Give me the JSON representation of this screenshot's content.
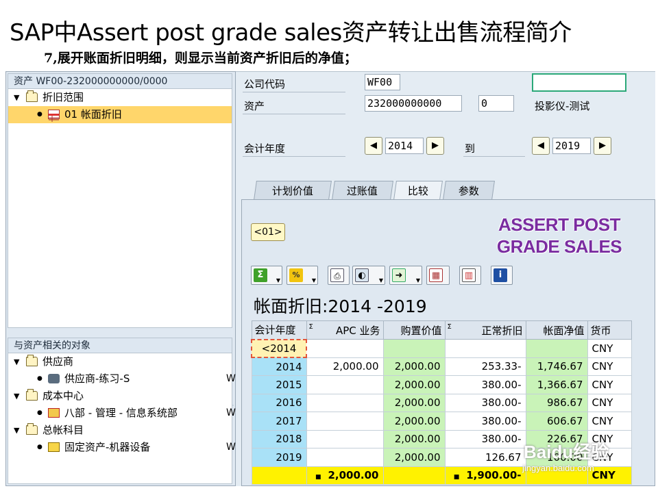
{
  "slide": {
    "title": "SAP中Assert post grade sales资产转让出售流程简介",
    "subtitle": "7,展开账面折旧明细，则显示当前资产折旧后的净值；"
  },
  "left_top": {
    "header": "资产 WF00-232000000000/0000",
    "items": [
      {
        "label": "折旧范围",
        "icon": "folder-icon"
      },
      {
        "label": "01  帐面折旧",
        "icon": "table-icon"
      }
    ]
  },
  "left_bottom": {
    "header": "与资产相关的对象",
    "groups": [
      {
        "label": "供应商",
        "child": "供应商-练习-S",
        "child_icon": "truck-icon",
        "trail": "W"
      },
      {
        "label": "成本中心",
        "child": "八部 - 管理 - 信息系统部",
        "child_icon": "cost-center-icon",
        "trail": "W"
      },
      {
        "label": "总帐科目",
        "child": "固定资产-机器设备",
        "child_icon": "gl-account-icon",
        "trail": "W"
      }
    ]
  },
  "header_fields": {
    "company_code_label": "公司代码",
    "company_code": "WF00",
    "asset_label": "资产",
    "asset_number": "232000000000",
    "sub_number": "0",
    "asset_desc": "投影仪-测试",
    "fiscal_year_label": "会计年度",
    "from_year": "2014",
    "to_label": "到",
    "to_year": "2019"
  },
  "tabs": [
    {
      "label": "计划价值",
      "active": false
    },
    {
      "label": "过账值",
      "active": false
    },
    {
      "label": "比较",
      "active": true
    },
    {
      "label": "参数",
      "active": false
    }
  ],
  "area_button": "<01>",
  "watermark_lines": [
    "ASSERT POST",
    "GRADE SALES"
  ],
  "toolbar_icons": [
    "sum-icon",
    "subtotal-icon",
    "print-icon",
    "view-icon",
    "export-icon",
    "layout-icon",
    "graphic-icon",
    "info-icon"
  ],
  "grid": {
    "title": "帐面折旧:2014 -2019",
    "columns": [
      "会计年度",
      "APC 业务",
      "购置价值",
      "正常折旧",
      "帐面净值",
      "货币"
    ],
    "rows": [
      {
        "year": "<2014",
        "apc": "",
        "purchase": "",
        "normal": "",
        "book": "",
        "curr": "CNY"
      },
      {
        "year": "2014",
        "apc": "2,000.00",
        "purchase": "2,000.00",
        "normal": "253.33-",
        "book": "1,746.67",
        "curr": "CNY"
      },
      {
        "year": "2015",
        "apc": "",
        "purchase": "2,000.00",
        "normal": "380.00-",
        "book": "1,366.67",
        "curr": "CNY"
      },
      {
        "year": "2016",
        "apc": "",
        "purchase": "2,000.00",
        "normal": "380.00-",
        "book": "986.67",
        "curr": "CNY"
      },
      {
        "year": "2017",
        "apc": "",
        "purchase": "2,000.00",
        "normal": "380.00-",
        "book": "606.67",
        "curr": "CNY"
      },
      {
        "year": "2018",
        "apc": "",
        "purchase": "2,000.00",
        "normal": "380.00-",
        "book": "226.67",
        "curr": "CNY"
      },
      {
        "year": "2019",
        "apc": "",
        "purchase": "2,000.00",
        "normal": "126.67",
        "book": "100.00",
        "curr": "CNY"
      }
    ],
    "total": {
      "apc": "2,000.00",
      "normal": "1,900.00-",
      "curr": "CNY"
    }
  },
  "credit": {
    "logo": "Baidu经验",
    "url": "jingyan.baidu.com"
  },
  "colors": {
    "watermark": "#7a2ca0",
    "total_row": "#fff200",
    "selected_row": "#ffd66b"
  }
}
